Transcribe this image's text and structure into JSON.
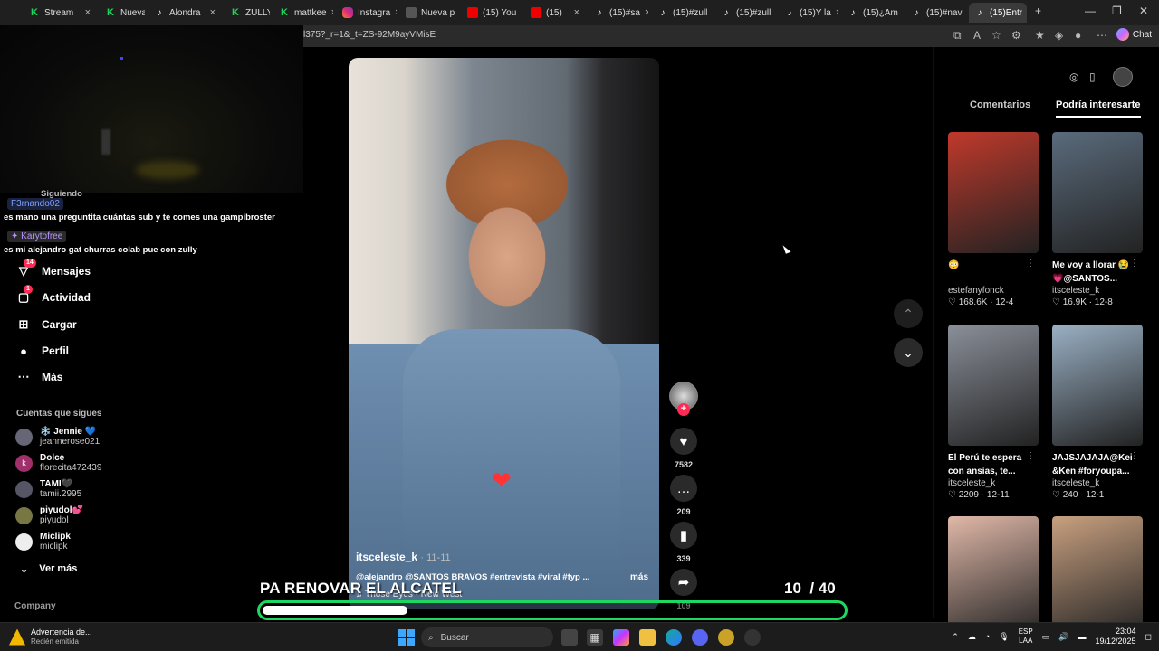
{
  "browser": {
    "tabs": [
      {
        "label": "Stream",
        "icon": "k-logo-icon"
      },
      {
        "label": "Nueva p",
        "icon": "k-logo-icon"
      },
      {
        "label": "Alondra",
        "icon": "tiktok-icon"
      },
      {
        "label": "ZULLYY_",
        "icon": "k-logo-icon"
      },
      {
        "label": "mattkee",
        "icon": "k-logo-icon"
      },
      {
        "label": "Instagra",
        "icon": "instagram-icon"
      },
      {
        "label": "Nueva p",
        "icon": "new-tab-icon"
      },
      {
        "label": "(15) You",
        "icon": "youtube-icon"
      },
      {
        "label": "(15)",
        "icon": "youtube-icon"
      },
      {
        "label": "(15)#sa",
        "icon": "tiktok-icon"
      },
      {
        "label": "(15)#zull",
        "icon": "tiktok-icon"
      },
      {
        "label": "(15)#zull",
        "icon": "tiktok-icon"
      },
      {
        "label": "(15)Y la",
        "icon": "tiktok-icon"
      },
      {
        "label": "(15)¿Am",
        "icon": "tiktok-icon"
      },
      {
        "label": "(15)#nav",
        "icon": "tiktok-icon"
      },
      {
        "label": "(15)Entr",
        "icon": "tiktok-icon"
      }
    ],
    "url": "l375?_r=1&_t=ZS-92M9ayVMisE",
    "chat_label": "Chat"
  },
  "stream_chat": {
    "partial_top": "Siguiendo",
    "user1": "F3rnando02",
    "msg1": "es mano una preguntita cuántas sub y te comes una gampibroster",
    "user2": "Karytofree",
    "msg2": "es mi alejandro gat churras colab pue con zully"
  },
  "nav": {
    "items": [
      {
        "label": "Mensajes",
        "icon": "send-icon",
        "badge": "14"
      },
      {
        "label": "Actividad",
        "icon": "inbox-icon",
        "badge": "1"
      },
      {
        "label": "Cargar",
        "icon": "upload-icon",
        "badge": ""
      },
      {
        "label": "Perfil",
        "icon": "profile-icon",
        "badge": ""
      },
      {
        "label": "Más",
        "icon": "more-icon",
        "badge": ""
      }
    ],
    "following_title": "Cuentas que sigues",
    "following": [
      {
        "name": "❄️ Jennie 💙",
        "handle": "jeannerose021",
        "initial": ""
      },
      {
        "name": "Dolce",
        "handle": "florecita472439",
        "initial": "k"
      },
      {
        "name": "TAMI🖤",
        "handle": "tamii.2995",
        "initial": ""
      },
      {
        "name": "piyudol💕",
        "handle": "piyudol",
        "initial": ""
      },
      {
        "name": "Miclipk",
        "handle": "miclipk",
        "initial": ""
      }
    ],
    "see_more": "Ver más",
    "company": "Company"
  },
  "video": {
    "author": "itsceleste_k",
    "date": "· 11-11",
    "caption": "@alejandro @SANTOS BRAVOS #entrevista #viral #fyp ...",
    "more": "más",
    "music": "♫ Those Eyes - New West",
    "likes": "7582",
    "comments": "209",
    "saves": "339",
    "shares": "109"
  },
  "right_panel": {
    "tab_comments": "Comentarios",
    "tab_interesting": "Podría interesarte",
    "thumbs": [
      {
        "title": "😳",
        "author": "estefanyfonck",
        "likes": "168.6K",
        "date": "12-4",
        "color": "#c0392b"
      },
      {
        "title": "Me voy a llorar 😭 💗@SANTOS...",
        "author": "itsceleste_k",
        "likes": "16.9K",
        "date": "12-8",
        "color": "#5a6b7c"
      },
      {
        "title": "El Perú te espera con ansias, te...",
        "author": "itsceleste_k",
        "likes": "2209",
        "date": "12-11",
        "color": "#8a8f99"
      },
      {
        "title": "JAJSJAJAJA@Kei &Ken #foryoupa...",
        "author": "itsceleste_k",
        "likes": "240",
        "date": "12-1",
        "color": "#9ab0c4"
      },
      {
        "title": "",
        "author": "",
        "likes": "",
        "date": "",
        "color": "#e0b8a8"
      },
      {
        "title": "",
        "author": "",
        "likes": "",
        "date": "",
        "color": "#c8a080"
      }
    ]
  },
  "overlay": {
    "text": "PA RENOVAR EL ALCATEL",
    "current": "10",
    "total": "/ 40",
    "progress": 0.25
  },
  "taskbar": {
    "notif_title": "Advertencia de...",
    "notif_sub": "Recién emitida",
    "search": "Buscar",
    "lang1": "ESP",
    "lang2": "LAA",
    "time": "23:04",
    "date": "19/12/2025"
  }
}
